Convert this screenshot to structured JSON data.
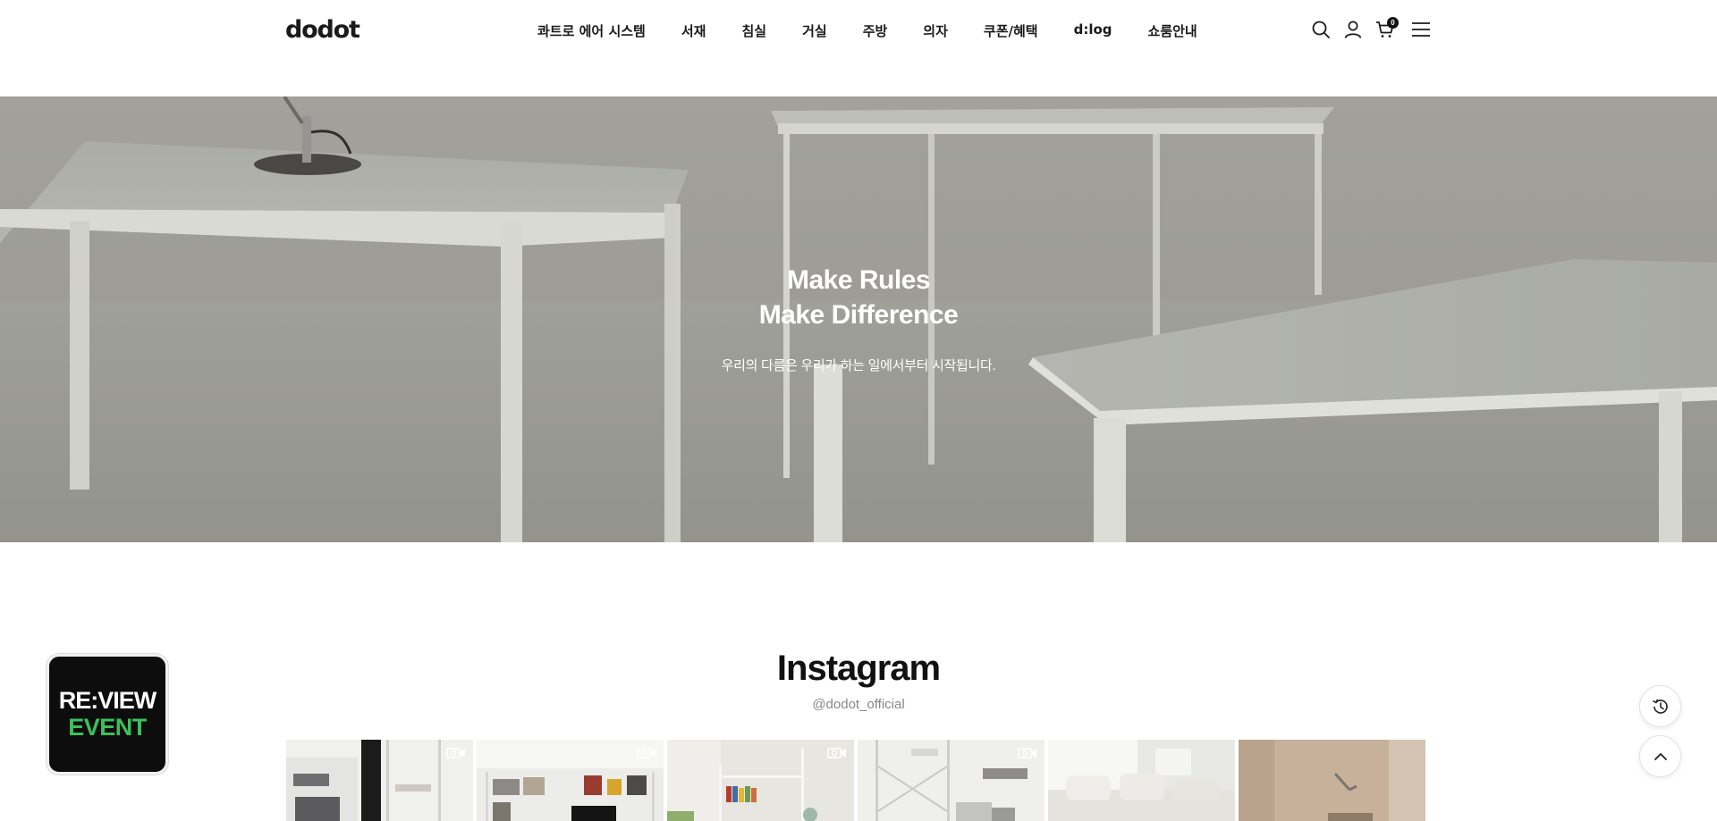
{
  "header": {
    "logo": "dodot",
    "nav": [
      "콰트로 에어 시스템",
      "서재",
      "침실",
      "거실",
      "주방",
      "의자",
      "쿠폰/혜택",
      "d:log",
      "쇼룸안내"
    ],
    "icons": [
      "search-icon",
      "user-icon",
      "cart-icon",
      "menu-icon"
    ],
    "cart_count": "0"
  },
  "hero": {
    "title_line1": "Make Rules",
    "title_line2": "Make Difference",
    "subtitle": "우리의 다름은 우리가 하는 일에서부터 시작됩니다."
  },
  "instagram": {
    "title": "Instagram",
    "handle": "@dodot_official",
    "tiles": [
      {
        "video": true
      },
      {
        "video": true
      },
      {
        "video": true
      },
      {
        "video": true
      },
      {
        "video": false
      },
      {
        "video": false
      }
    ]
  },
  "review_badge": {
    "line1": "RE:VIEW",
    "line2": "EVENT",
    "accent_color": "#3bc25a"
  },
  "floating_buttons": [
    "history-icon",
    "arrow-up-icon"
  ]
}
